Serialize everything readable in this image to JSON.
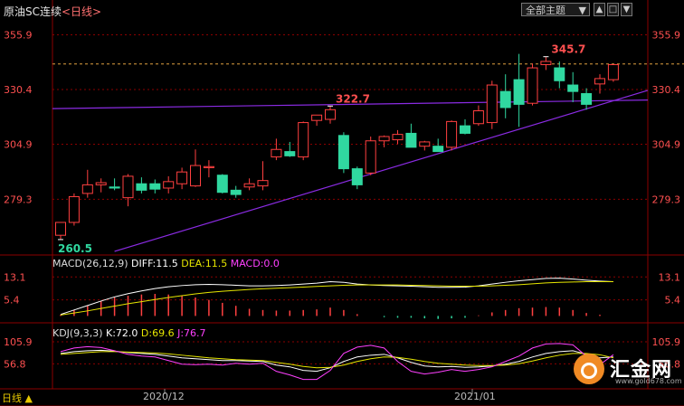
{
  "header": {
    "title": "原油SC连续",
    "period": "<日线>"
  },
  "toolbar": {
    "theme_label": "全部主题",
    "theme_arrow": "▼"
  },
  "macd_header": {
    "label": "MACD(26,12,9)",
    "diff": "DIFF:11.5",
    "dea": "DEA:11.5",
    "macd": "MACD:0.0"
  },
  "kdj_header": {
    "label": "KDJ(9,3,3)",
    "k": "K:72.0",
    "d": "D:69.6",
    "j": "J:76.7"
  },
  "bottom_bar": {
    "period": "日线 ▲"
  },
  "dates": [
    "2020/12",
    "2021/01"
  ],
  "watermark": {
    "name": "汇金网",
    "url": "www.gold678.com"
  },
  "colors": {
    "up": "#ff4040",
    "down": "#30d8a0",
    "grid": "#8b0000",
    "axis_text": "#ff5050",
    "trend": "#8a2be2"
  },
  "chart_data": [
    {
      "type": "candlestick",
      "name": "price",
      "ylim": [
        255,
        362
      ],
      "y_ticks": [
        355.9,
        330.4,
        304.9,
        279.3
      ],
      "y_tick_labels": [
        "355.9",
        "330.4",
        "304.9",
        "279.3"
      ],
      "price_line": 342.3,
      "annotations": [
        {
          "label": "345.7",
          "index": 36,
          "value": 345.7
        },
        {
          "label": "322.7",
          "index": 20,
          "value": 322.7
        },
        {
          "label": "260.5",
          "index": 0,
          "value": 260.5
        }
      ],
      "candles": [
        [
          262.5,
          268.5,
          260.5,
          268.5
        ],
        [
          268.5,
          282.0,
          267.0,
          280.5
        ],
        [
          282.0,
          293.0,
          280.0,
          286.0
        ],
        [
          286.0,
          289.0,
          282.5,
          287.0
        ],
        [
          285.0,
          289.0,
          283.5,
          284.5
        ],
        [
          280.0,
          291.0,
          276.0,
          290.0
        ],
        [
          286.5,
          289.5,
          282.0,
          283.5
        ],
        [
          286.5,
          288.5,
          282.0,
          284.0
        ],
        [
          284.5,
          290.0,
          282.0,
          287.5
        ],
        [
          286.5,
          294.0,
          284.0,
          292.0
        ],
        [
          285.5,
          302.5,
          285.0,
          295.0
        ],
        [
          294.0,
          297.5,
          289.5,
          294.5
        ],
        [
          290.5,
          291.0,
          282.0,
          282.5
        ],
        [
          283.5,
          285.5,
          280.0,
          281.5
        ],
        [
          285.0,
          289.0,
          283.5,
          286.5
        ],
        [
          285.5,
          297.0,
          283.5,
          288.0
        ],
        [
          299.0,
          307.5,
          297.5,
          302.5
        ],
        [
          301.5,
          306.0,
          299.0,
          299.5
        ],
        [
          299.0,
          315.5,
          297.5,
          315.0
        ],
        [
          316.0,
          318.5,
          313.5,
          318.5
        ],
        [
          316.5,
          322.7,
          314.5,
          321.0
        ],
        [
          309.0,
          310.5,
          291.5,
          293.5
        ],
        [
          293.5,
          294.5,
          284.0,
          286.0
        ],
        [
          291.5,
          308.5,
          290.5,
          306.5
        ],
        [
          306.5,
          309.0,
          303.5,
          308.5
        ],
        [
          307.0,
          311.5,
          305.0,
          309.5
        ],
        [
          310.0,
          314.5,
          304.5,
          303.5
        ],
        [
          304.0,
          306.5,
          302.0,
          306.0
        ],
        [
          304.0,
          307.5,
          301.5,
          301.5
        ],
        [
          303.5,
          316.0,
          302.0,
          315.5
        ],
        [
          313.5,
          316.5,
          309.5,
          310.0
        ],
        [
          314.5,
          323.0,
          313.5,
          320.5
        ],
        [
          315.0,
          334.5,
          312.0,
          332.5
        ],
        [
          329.5,
          337.5,
          317.0,
          322.0
        ],
        [
          335.0,
          347.0,
          313.0,
          323.5
        ],
        [
          324.0,
          342.5,
          323.0,
          340.5
        ],
        [
          342.0,
          345.7,
          339.5,
          343.5
        ],
        [
          340.5,
          343.5,
          331.0,
          334.5
        ],
        [
          332.5,
          338.5,
          324.5,
          329.5
        ],
        [
          328.5,
          331.0,
          321.0,
          323.5
        ],
        [
          333.0,
          337.5,
          328.5,
          335.5
        ],
        [
          335.0,
          342.0,
          334.0,
          342.0
        ]
      ]
    },
    {
      "type": "line+bar",
      "name": "MACD",
      "ylim": [
        -2,
        15
      ],
      "y_ticks": [
        13.1,
        5.4
      ],
      "y_tick_labels": [
        "13.1",
        "5.4"
      ],
      "diff": [
        0.5,
        2.0,
        3.5,
        5.0,
        6.4,
        7.5,
        8.4,
        9.2,
        9.8,
        10.2,
        10.5,
        10.6,
        10.5,
        10.3,
        10.1,
        10.1,
        10.2,
        10.4,
        10.7,
        11.0,
        11.5,
        11.3,
        10.7,
        10.4,
        10.2,
        10.1,
        10.0,
        9.8,
        9.6,
        9.6,
        9.7,
        10.1,
        10.7,
        11.3,
        11.8,
        12.2,
        12.6,
        12.7,
        12.4,
        12.0,
        11.7,
        11.5
      ],
      "dea": [
        0.3,
        1.0,
        1.7,
        2.5,
        3.3,
        4.1,
        4.8,
        5.5,
        6.2,
        6.8,
        7.4,
        7.9,
        8.3,
        8.6,
        8.9,
        9.1,
        9.3,
        9.5,
        9.7,
        9.9,
        10.1,
        10.3,
        10.4,
        10.4,
        10.4,
        10.4,
        10.3,
        10.2,
        10.1,
        10.0,
        10.0,
        10.0,
        10.1,
        10.3,
        10.5,
        10.8,
        11.1,
        11.3,
        11.4,
        11.5,
        11.5,
        11.5
      ],
      "macd": [
        0.4,
        2.0,
        3.6,
        5.0,
        6.2,
        6.8,
        7.2,
        7.4,
        7.2,
        6.8,
        6.2,
        5.4,
        4.4,
        3.4,
        2.4,
        2.0,
        1.8,
        1.8,
        2.0,
        2.2,
        2.8,
        2.0,
        0.6,
        0.0,
        -0.4,
        -0.6,
        -0.6,
        -0.8,
        -1.0,
        -0.8,
        -0.6,
        0.2,
        1.2,
        2.0,
        2.6,
        2.8,
        3.0,
        2.8,
        2.0,
        1.0,
        0.4,
        0.0
      ]
    },
    {
      "type": "line",
      "name": "KDJ",
      "ylim": [
        5,
        118
      ],
      "y_ticks": [
        105.9,
        56.8
      ],
      "y_tick_labels": [
        "105.9",
        "56.8"
      ],
      "k": [
        80,
        84,
        86,
        87,
        85,
        82,
        80,
        78,
        74,
        70,
        68,
        66,
        64,
        64,
        63,
        62,
        54,
        50,
        42,
        40,
        48,
        62,
        72,
        76,
        78,
        70,
        60,
        52,
        50,
        51,
        49,
        50,
        52,
        56,
        62,
        72,
        80,
        84,
        86,
        78,
        70,
        72
      ],
      "d": [
        78,
        80,
        82,
        84,
        84,
        83,
        82,
        81,
        79,
        76,
        73,
        70,
        68,
        66,
        65,
        64,
        60,
        56,
        51,
        48,
        49,
        54,
        62,
        68,
        72,
        71,
        67,
        62,
        58,
        56,
        54,
        53,
        53,
        54,
        57,
        63,
        70,
        76,
        80,
        80,
        77,
        70
      ],
      "j": [
        84,
        92,
        95,
        93,
        86,
        78,
        74,
        72,
        64,
        56,
        55,
        56,
        54,
        58,
        56,
        58,
        40,
        32,
        22,
        22,
        42,
        80,
        94,
        98,
        92,
        62,
        40,
        34,
        38,
        44,
        40,
        44,
        50,
        62,
        74,
        92,
        101,
        102,
        99,
        74,
        55,
        77
      ]
    }
  ]
}
